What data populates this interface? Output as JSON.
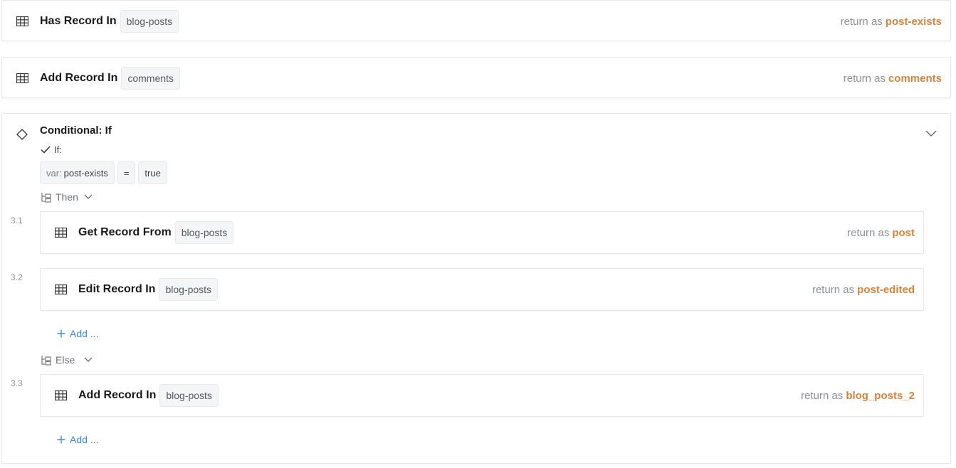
{
  "steps": [
    {
      "icon": "table-icon",
      "action": "Has Record In",
      "collection": "blog-posts",
      "return_prefix": "return as",
      "return_var": "post-exists"
    },
    {
      "icon": "table-icon",
      "action": "Add Record In",
      "collection": "comments",
      "return_prefix": "return as",
      "return_var": "comments"
    }
  ],
  "conditional": {
    "icon": "diamond-icon",
    "title": "Conditional: If",
    "if_label": "If:",
    "condition": {
      "var_prefix": "var:",
      "var_name": "post-exists",
      "operator": "=",
      "value": "true"
    },
    "then_label": "Then",
    "else_label": "Else",
    "then_steps": [
      {
        "num": "3.1",
        "action": "Get Record From",
        "collection": "blog-posts",
        "return_prefix": "return as",
        "return_var": "post"
      },
      {
        "num": "3.2",
        "action": "Edit Record In",
        "collection": "blog-posts",
        "return_prefix": "return as",
        "return_var": "post-edited"
      }
    ],
    "else_steps": [
      {
        "num": "3.3",
        "action": "Add Record In",
        "collection": "blog-posts",
        "return_prefix": "return as",
        "return_var": "blog_posts_2"
      }
    ],
    "add_label": "Add ..."
  },
  "colors": {
    "accent": "#d8833a",
    "link": "#3a8bd4",
    "border": "#e3e6ea"
  }
}
